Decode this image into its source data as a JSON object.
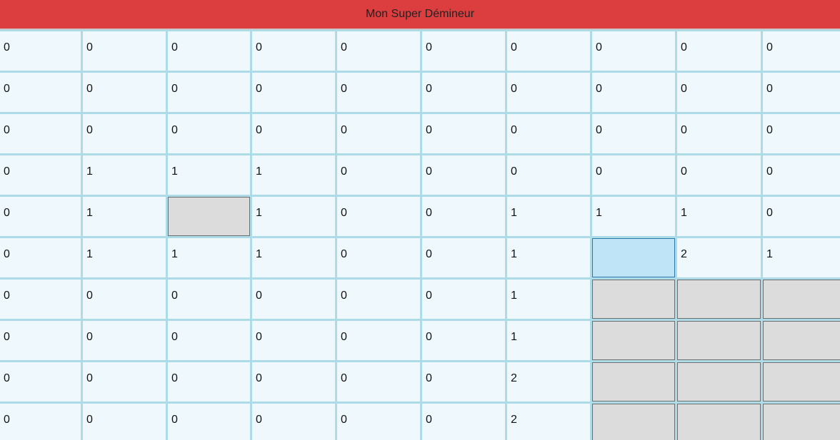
{
  "title": "Mon Super Démineur",
  "colors": {
    "title_bar": "#dc3e3f",
    "revealed_cell": "#eff8fd",
    "hidden_cell": "#dcdcdc",
    "hovered_cell": "#bfe4f8",
    "grid_line": "#aedbe8"
  },
  "board": {
    "rows": [
      [
        "0",
        "0",
        "0",
        "0",
        "0",
        "0",
        "0",
        "0",
        "0",
        "0"
      ],
      [
        "0",
        "0",
        "0",
        "0",
        "0",
        "0",
        "0",
        "0",
        "0",
        "0"
      ],
      [
        "0",
        "0",
        "0",
        "0",
        "0",
        "0",
        "0",
        "0",
        "0",
        "0"
      ],
      [
        "0",
        "1",
        "1",
        "1",
        "0",
        "0",
        "0",
        "0",
        "0",
        "0"
      ],
      [
        "0",
        "1",
        null,
        "1",
        "0",
        "0",
        "1",
        "1",
        "1",
        "0"
      ],
      [
        "0",
        "1",
        "1",
        "1",
        "0",
        "0",
        "1",
        null,
        "2",
        "1"
      ],
      [
        "0",
        "0",
        "0",
        "0",
        "0",
        "0",
        "1",
        null,
        null,
        null
      ],
      [
        "0",
        "0",
        "0",
        "0",
        "0",
        "0",
        "1",
        null,
        null,
        null
      ],
      [
        "0",
        "0",
        "0",
        "0",
        "0",
        "0",
        "2",
        null,
        null,
        null
      ],
      [
        "0",
        "0",
        "0",
        "0",
        "0",
        "0",
        "2",
        null,
        null,
        null
      ]
    ],
    "hovered_cell": [
      5,
      7
    ]
  }
}
